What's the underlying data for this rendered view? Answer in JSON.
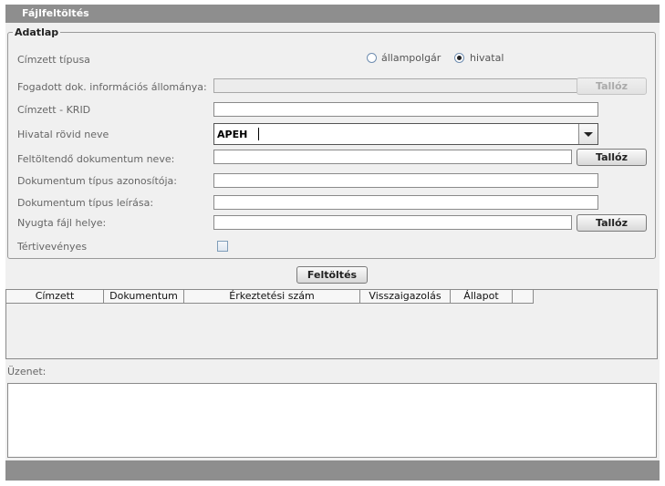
{
  "window": {
    "title": "Fájlfeltöltés"
  },
  "form": {
    "legend": "Adatlap",
    "recipient_type": {
      "label": "Címzett típusa",
      "options": [
        "állampolgár",
        "hivatal"
      ],
      "selected": "hivatal"
    },
    "received_doc_info": {
      "label": "Fogadott dok. információs állománya:",
      "value": "",
      "browse_label": "Tallóz",
      "browse_enabled": false
    },
    "recipient_krid": {
      "label": "Címzett - KRID",
      "value": ""
    },
    "office_short_name": {
      "label": "Hivatal rövid neve",
      "value": "APEH"
    },
    "upload_doc_name": {
      "label": "Feltöltendő dokumentum neve:",
      "value": "",
      "browse_label": "Tallóz"
    },
    "doc_type_id": {
      "label": "Dokumentum típus azonosítója:",
      "value": ""
    },
    "doc_type_desc": {
      "label": "Dokumentum típus leírása:",
      "value": ""
    },
    "receipt_file_location": {
      "label": "Nyugta fájl helye:",
      "value": "",
      "browse_label": "Tallóz"
    },
    "return_receipt": {
      "label": "Tértivevényes",
      "checked": false
    }
  },
  "upload_button": {
    "label": "Feltöltés"
  },
  "table": {
    "columns": [
      "Címzett",
      "Dokumentum",
      "Érkeztetési szám",
      "Visszaigazolás",
      "Állapot",
      ""
    ],
    "rows": []
  },
  "message": {
    "label": "Üzenet:",
    "value": ""
  }
}
